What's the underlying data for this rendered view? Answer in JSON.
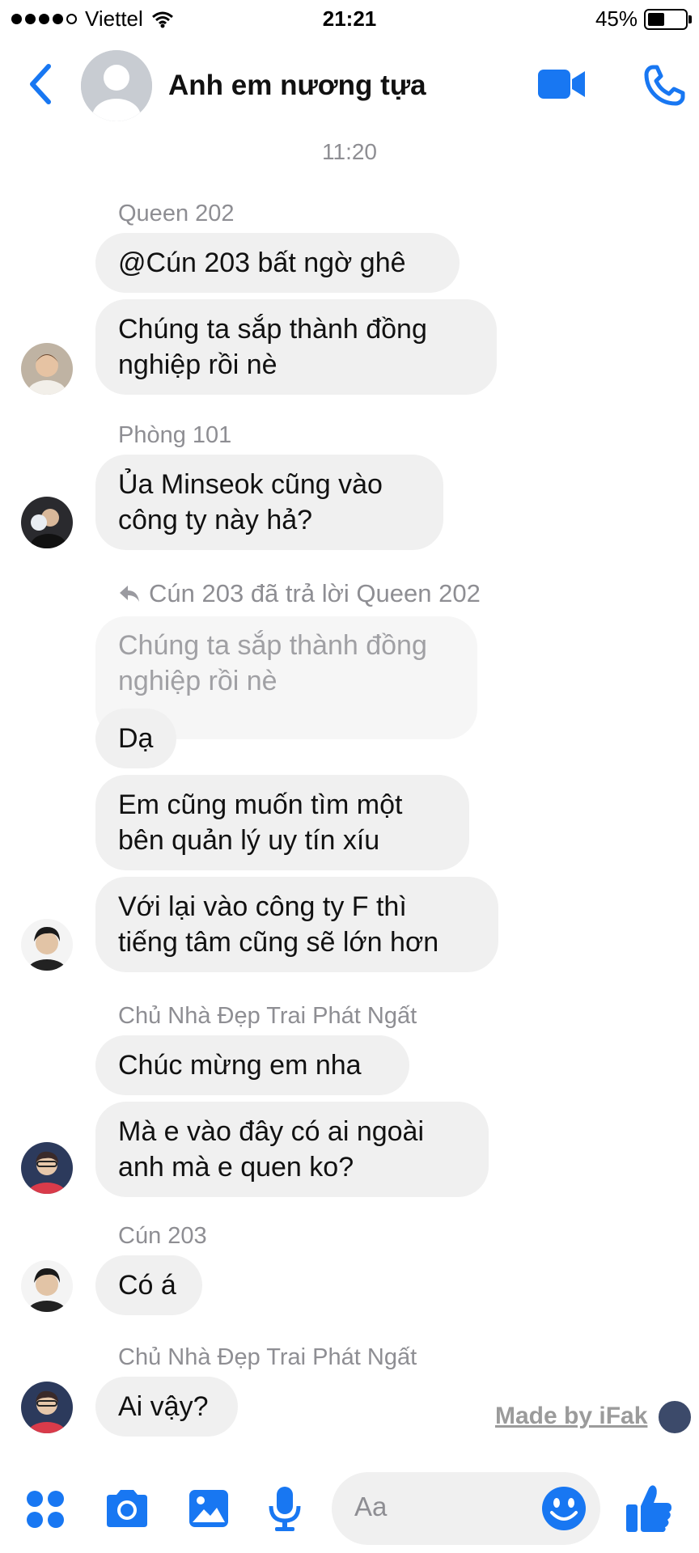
{
  "status_bar": {
    "carrier": "Viettel",
    "time": "21:21",
    "battery": "45%",
    "battery_level": 0.45
  },
  "header": {
    "title": "Anh em nương tựa"
  },
  "time_separator": "11:20",
  "messages": {
    "m1": {
      "sender": "Queen 202",
      "b1": "@Cún 203 bất ngờ ghê",
      "b2a": "Chúng ta sắp thành đồng",
      "b2b": "nghiệp rồi nè"
    },
    "m2": {
      "sender": "Phòng 101",
      "b1a": "Ủa Minseok cũng vào",
      "b1b": "công ty này hả?"
    },
    "m3": {
      "reply_label": "Cún 203 đã trả lời Queen 202",
      "quote_a": "Chúng ta sắp thành đồng",
      "quote_b": "nghiệp rồi nè",
      "b1": "Dạ",
      "b2a": "Em cũng muốn tìm một",
      "b2b": "bên quản lý uy tín xíu",
      "b3a": "Với lại vào công ty F thì",
      "b3b": "tiếng tâm cũng sẽ lớn hơn"
    },
    "m4": {
      "sender": "Chủ Nhà Đẹp Trai Phát Ngất",
      "b1": "Chúc mừng em nha",
      "b2a": "Mà e vào đây có ai ngoài",
      "b2b": "anh mà e quen ko?"
    },
    "m5": {
      "sender": "Cún 203",
      "b1": "Có á"
    },
    "m6": {
      "sender": "Chủ Nhà Đẹp Trai Phát Ngất",
      "b1": "Ai vậy?"
    }
  },
  "watermark": "Made by iFak",
  "composer": {
    "placeholder": "Aa"
  },
  "colors": {
    "accent": "#1877f2",
    "bubble": "#f0f0f0",
    "meta_text": "#8e8e93"
  },
  "icons": [
    "back-chevron-icon",
    "video-camera-icon",
    "phone-icon",
    "apps-grid-icon",
    "camera-icon",
    "image-icon",
    "microphone-icon",
    "smiley-icon",
    "thumbs-up-icon"
  ]
}
